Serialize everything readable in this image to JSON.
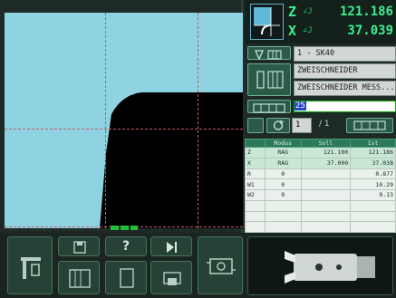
{
  "axes": [
    {
      "letter": "Z",
      "mode": "∠J",
      "value": "121.186"
    },
    {
      "letter": "X",
      "mode": "∠J",
      "value": "37.039"
    }
  ],
  "tool_info": {
    "tool_id": "1 - SK40",
    "description1": "ZWEISCHNEIDER",
    "description2": "ZWEISCHNEIDER MESS..."
  },
  "input": {
    "selected_text": "25"
  },
  "pagination": {
    "current": "1",
    "separator": "/",
    "total": "1"
  },
  "table": {
    "headers": [
      "",
      "Modus",
      "Soll",
      "Ist"
    ],
    "rows": [
      {
        "axis": "Z",
        "mode": "RAG",
        "soll": "121.100",
        "ist": "121.186"
      },
      {
        "axis": "X",
        "mode": "RAG",
        "soll": "37.000",
        "ist": "37.038"
      },
      {
        "axis": "R",
        "mode": "0",
        "soll": "",
        "ist": "0.877"
      },
      {
        "axis": "W1",
        "mode": "0",
        "soll": "",
        "ist": "10.29"
      },
      {
        "axis": "W2",
        "mode": "0",
        "soll": "",
        "ist": "0.13"
      },
      {
        "axis": "",
        "mode": "",
        "soll": "",
        "ist": ""
      },
      {
        "axis": "",
        "mode": "",
        "soll": "",
        "ist": ""
      },
      {
        "axis": "",
        "mode": "",
        "soll": "",
        "ist": ""
      }
    ]
  },
  "toolbar": {
    "help_label": "?"
  },
  "icons": {
    "view": "view-quadrant-icon",
    "tool_table": "tool-table-icon",
    "holder": "tool-holder-icon"
  },
  "colors": {
    "accent_green": "#3df08e",
    "canvas": "#8fd3e2",
    "selection": "#2a46c8",
    "crosshair": "#c85a64"
  }
}
